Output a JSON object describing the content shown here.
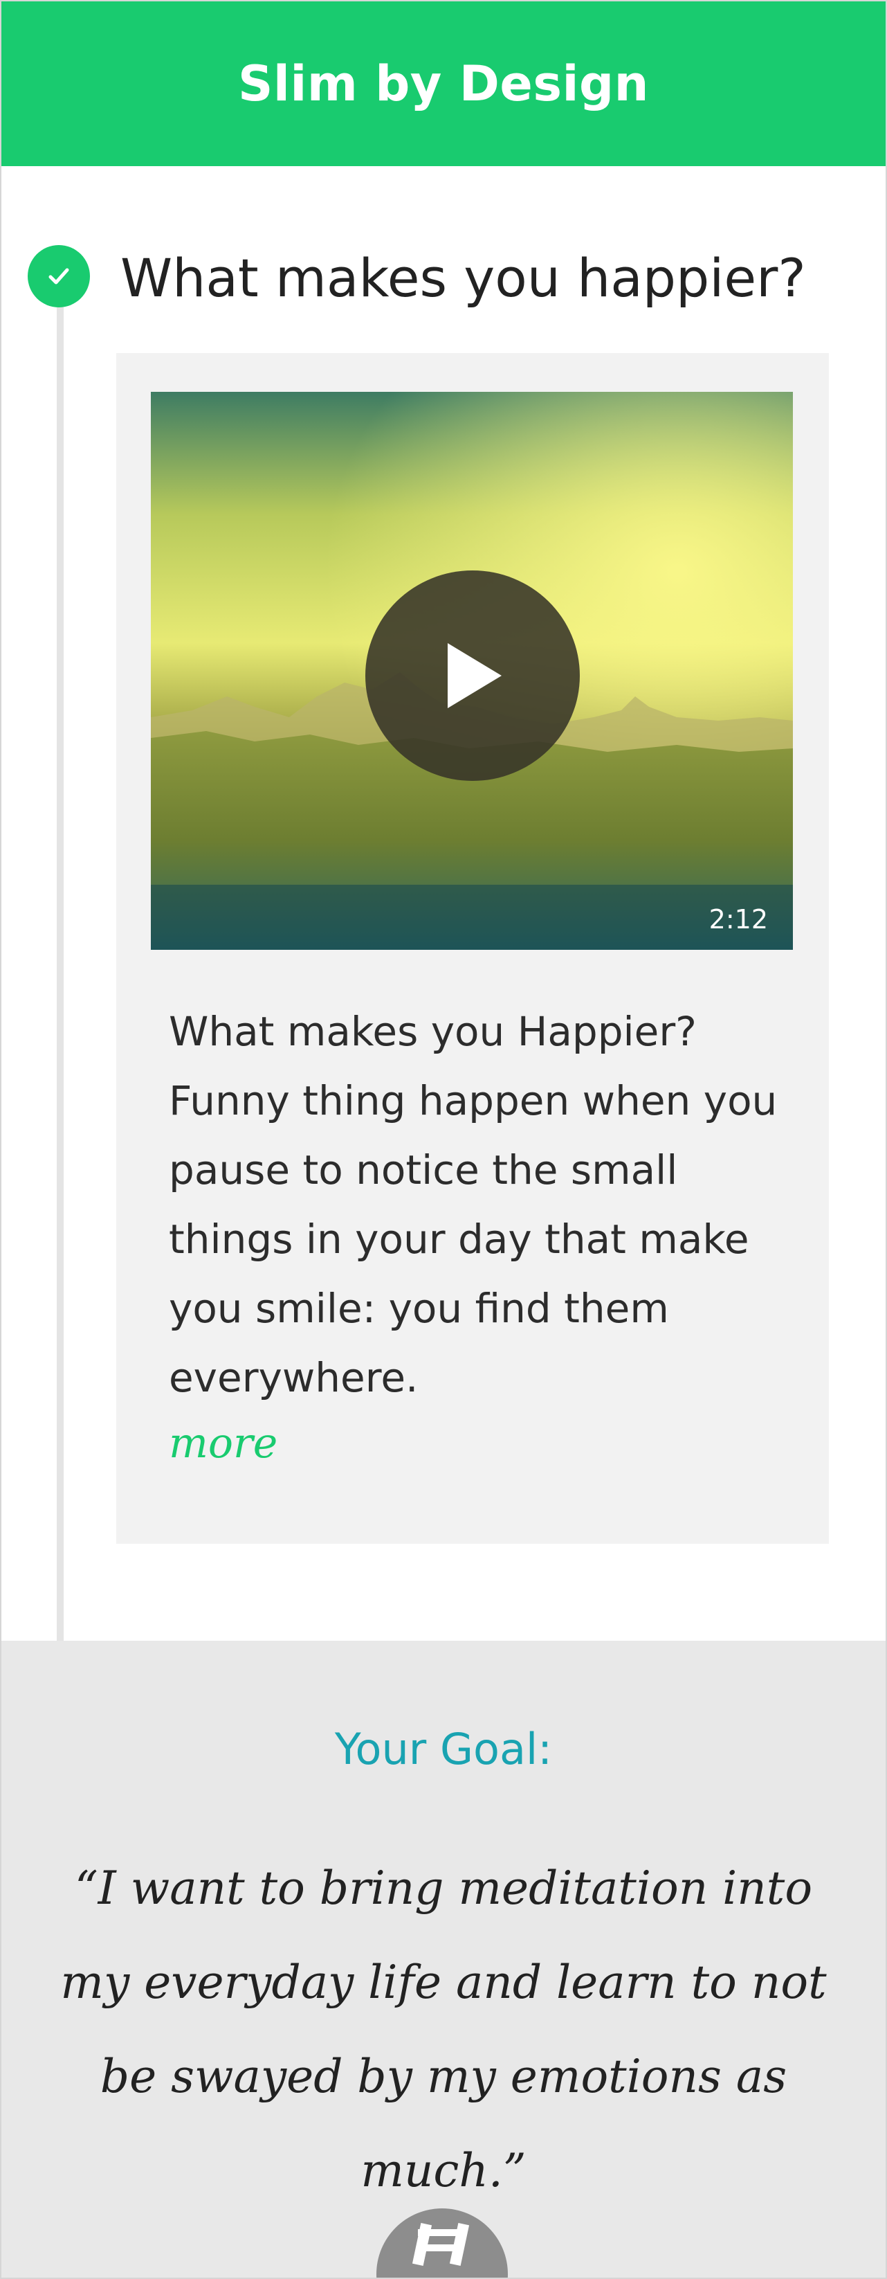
{
  "header": {
    "title": "Slim by Design"
  },
  "step": {
    "title": "What makes you happier?",
    "status_icon": "check-icon"
  },
  "card": {
    "video": {
      "duration": "2:12",
      "play_icon": "play-icon"
    },
    "description": "What makes you Happier? Funny thing happen when you pause to notice the small things in your day that make you smile: you find them everywhere.",
    "more_label": "more"
  },
  "goal": {
    "label": "Your Goal:",
    "quote": "“I want to bring meditation into my everyday life and learn to not be swayed by my emotions as much.”"
  },
  "colors": {
    "brand_green": "#19cb6f",
    "goal_label_teal": "#19a3b1",
    "goal_background": "#e8e8e8",
    "card_background": "#f2f2f2"
  }
}
